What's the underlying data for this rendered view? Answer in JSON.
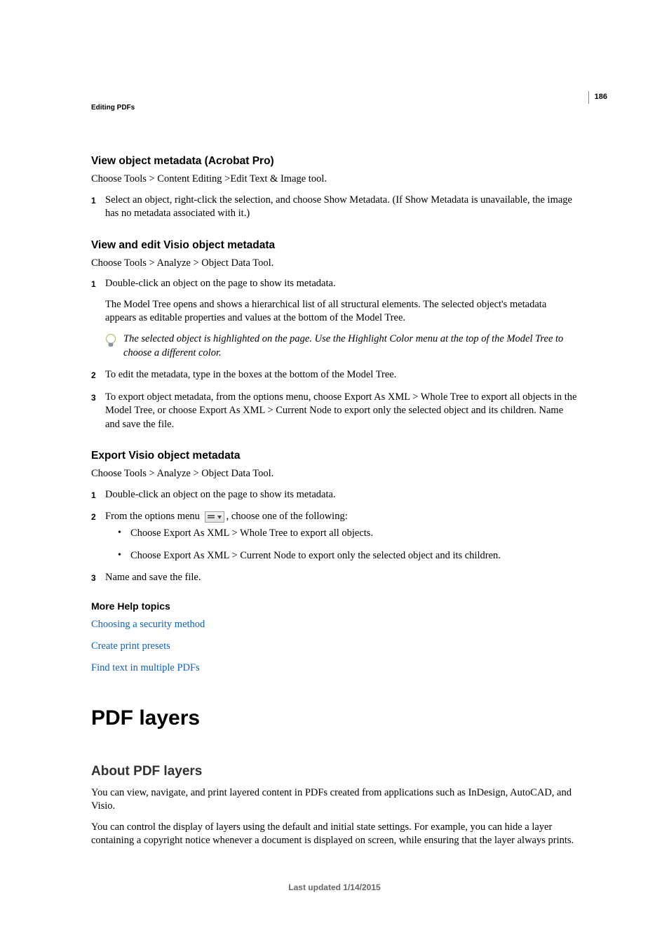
{
  "page_number": "186",
  "running_head": "Editing PDFs",
  "s1": {
    "heading": "View object metadata (Acrobat Pro)",
    "intro": "Choose Tools > Content Editing >Edit Text & Image tool.",
    "step1": "Select an object, right-click the selection, and choose Show Metadata. (If Show Metadata is unavailable, the image has no metadata associated with it.)"
  },
  "s2": {
    "heading": "View and edit Visio object metadata",
    "intro": "Choose Tools > Analyze > Object Data Tool.",
    "step1a": "Double-click an object on the page to show its metadata.",
    "step1b": "The Model Tree opens and shows a hierarchical list of all structural elements. The selected object's metadata appears as editable properties and values at the bottom of the Model Tree.",
    "tip": "The selected object is highlighted on the page. Use the Highlight Color menu at the top of the Model Tree to choose a different color.",
    "step2": "To edit the metadata, type in the boxes at the bottom of the Model Tree.",
    "step3": "To export object metadata, from the options menu, choose Export As XML > Whole Tree to export all objects in the Model Tree, or choose Export As XML > Current Node to export only the selected object and its children. Name and save the file."
  },
  "s3": {
    "heading": "Export Visio object metadata",
    "intro": "Choose Tools > Analyze > Object Data Tool.",
    "step1": "Double-click an object on the page to show its metadata.",
    "step2a": "From the options menu ",
    "step2b": ", choose one of the following:",
    "bullet1": "Choose Export As XML > Whole Tree to export all objects.",
    "bullet2": "Choose Export As XML > Current Node to export only the selected object and its children.",
    "step3": "Name and save the file."
  },
  "more_help": {
    "heading": "More Help topics",
    "link1": "Choosing a security method",
    "link2": "Create print presets",
    "link3": "Find text in multiple PDFs"
  },
  "pdf_layers": {
    "title": "PDF layers",
    "subtitle": "About PDF layers",
    "p1": "You can view, navigate, and print layered content in PDFs created from applications such as InDesign, AutoCAD, and Visio.",
    "p2": "You can control the display of layers using the default and initial state settings. For example, you can hide a layer containing a copyright notice whenever a document is displayed on screen, while ensuring that the layer always prints."
  },
  "footer": "Last updated 1/14/2015"
}
